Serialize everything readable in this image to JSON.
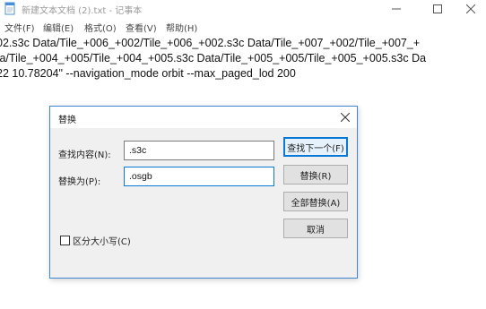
{
  "window": {
    "title": "新建文本文档 (2).txt - 记事本",
    "minimize_icon": "minimize-icon",
    "maximize_icon": "maximize-icon",
    "close_icon": "close-icon"
  },
  "menu": {
    "items": [
      {
        "label": "文件(F)"
      },
      {
        "label": "编辑(E)"
      },
      {
        "label": "格式(O)"
      },
      {
        "label": "查看(V)"
      },
      {
        "label": "帮助(H)"
      }
    ]
  },
  "editor": {
    "lines": [
      "02.s3c Data/Tile_+006_+002/Tile_+006_+002.s3c Data/Tile_+007_+002/Tile_+007_+",
      ":a/Tile_+004_+005/Tile_+004_+005.s3c Data/Tile_+005_+005/Tile_+005_+005.s3c Da",
      "22 10.78204\" --navigation_mode orbit --max_paged_lod 200"
    ]
  },
  "dialog": {
    "title": "替换",
    "find_label": "查找内容(N):",
    "find_value": ".s3c",
    "replace_label": "替换为(P):",
    "replace_value": ".osgb",
    "find_next_button": "查找下一个(F)",
    "replace_button": "替换(R)",
    "replace_all_button": "全部替换(A)",
    "cancel_button": "取消",
    "match_case_label": "区分大小写(C)"
  },
  "colors": {
    "accent": "#0a78d7",
    "dialog_border": "#3f86d2",
    "dialog_bg": "#f0f0f0",
    "button_bg": "#e1e1e1"
  }
}
